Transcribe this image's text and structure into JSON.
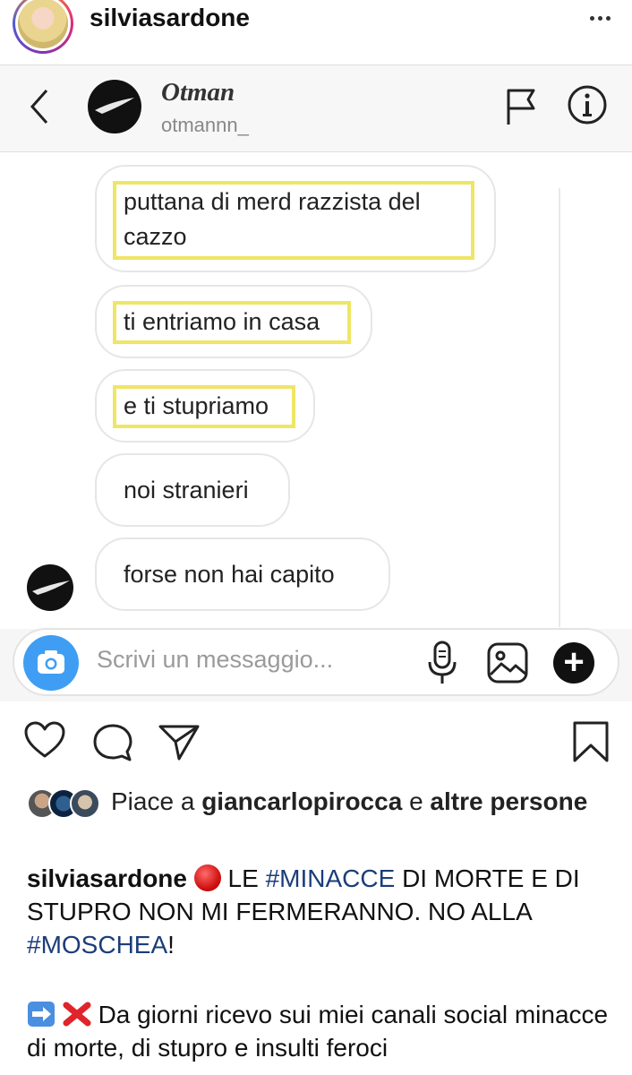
{
  "post": {
    "username": "silviasardone"
  },
  "dm": {
    "contact_name": "Otman",
    "contact_handle": "otmannn_",
    "messages": [
      "puttana di merd razzista del",
      "cazzo",
      "ti entriamo in casa",
      "e ti stupriamo",
      "noi stranieri",
      "forse non hai capito"
    ],
    "composer_placeholder": "Scrivi un messaggio..."
  },
  "likes": {
    "prefix": "Piace a",
    "user": "giancarlopirocca",
    "conjunction": "e",
    "rest": "altre persone"
  },
  "caption": {
    "username": "silviasardone",
    "text_1": "LE",
    "hashtag_1": "#MINACCE",
    "text_2": "DI MORTE E DI STUPRO NON MI FERMERANNO. NO ALLA",
    "hashtag_2": "#MOSCHEA",
    "text_3": "!",
    "body": "Da giorni ricevo sui miei canali social minacce di morte, di stupro e insulti feroci"
  },
  "colors": {
    "highlight": "#efe665",
    "hashtag": "#1b3d7a",
    "camera": "#3f9ef3"
  }
}
